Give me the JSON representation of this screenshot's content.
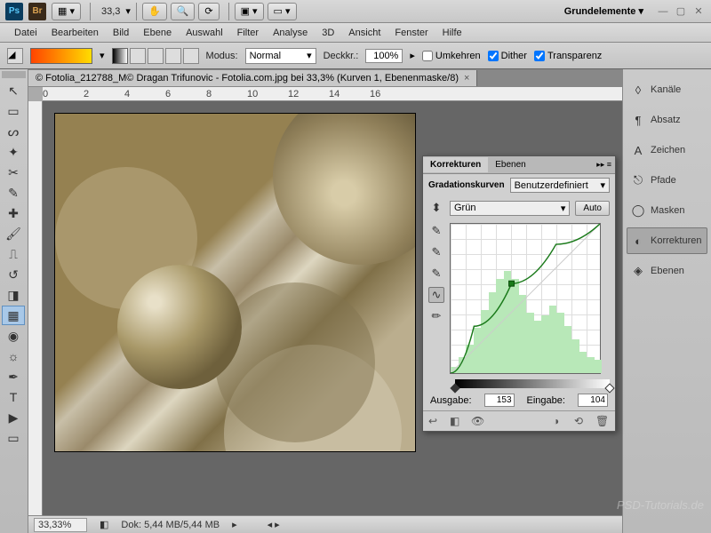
{
  "topbar": {
    "zoom": "33,3",
    "workspace": "Grundelemente"
  },
  "menu": [
    "Datei",
    "Bearbeiten",
    "Bild",
    "Ebene",
    "Auswahl",
    "Filter",
    "Analyse",
    "3D",
    "Ansicht",
    "Fenster",
    "Hilfe"
  ],
  "options": {
    "modus_label": "Modus:",
    "modus_value": "Normal",
    "deckkraft_label": "Deckkr.:",
    "deckkraft_value": "100%",
    "umkehren": "Umkehren",
    "dither": "Dither",
    "transparenz": "Transparenz"
  },
  "tab": {
    "title": "© Fotolia_212788_M© Dragan Trifunovic - Fotolia.com.jpg bei 33,3% (Kurven 1, Ebenenmaske/8)"
  },
  "ruler_marks": [
    0,
    2,
    4,
    6,
    8,
    10,
    12,
    14,
    16
  ],
  "status": {
    "zoom": "33,33%",
    "doc": "Dok: 5,44 MB/5,44 MB"
  },
  "side_panels": [
    {
      "icon": "◊",
      "label": "Kanäle"
    },
    {
      "icon": "¶",
      "label": "Absatz"
    },
    {
      "icon": "A",
      "label": "Zeichen"
    },
    {
      "icon": "⎋",
      "label": "Pfade"
    },
    {
      "icon": "◯",
      "label": "Masken"
    },
    {
      "icon": "◐",
      "label": "Korrekturen",
      "active": true
    },
    {
      "icon": "◈",
      "label": "Ebenen"
    }
  ],
  "curves": {
    "tab1": "Korrekturen",
    "tab2": "Ebenen",
    "title": "Gradationskurven",
    "preset": "Benutzerdefiniert",
    "channel": "Grün",
    "auto": "Auto",
    "ausgabe_label": "Ausgabe:",
    "ausgabe_value": "153",
    "eingabe_label": "Eingabe:",
    "eingabe_value": "104"
  },
  "chart_data": {
    "type": "line",
    "title": "Gradationskurven – Grün",
    "xlabel": "Eingabe",
    "ylabel": "Ausgabe",
    "xlim": [
      0,
      255
    ],
    "ylim": [
      0,
      255
    ],
    "curve_points": [
      {
        "x": 0,
        "y": 0
      },
      {
        "x": 40,
        "y": 80
      },
      {
        "x": 104,
        "y": 153
      },
      {
        "x": 180,
        "y": 220
      },
      {
        "x": 255,
        "y": 255
      }
    ],
    "selected_point": {
      "x": 104,
      "y": 153
    },
    "histogram": [
      5,
      12,
      22,
      35,
      48,
      62,
      72,
      78,
      72,
      60,
      46,
      40,
      44,
      52,
      46,
      36,
      26,
      16,
      12,
      10
    ]
  },
  "watermark": "PSD-Tutorials.de"
}
